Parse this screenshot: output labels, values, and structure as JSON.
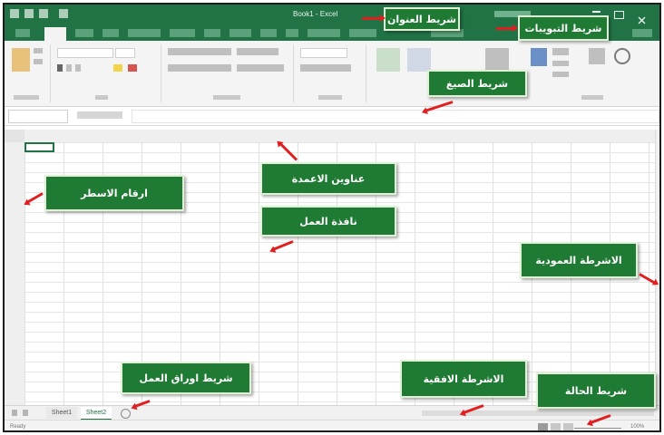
{
  "window": {
    "title": "Book1 - Excel",
    "sheet_tabs": [
      "Sheet1",
      "Sheet2"
    ],
    "status": "Ready",
    "zoom": "100%"
  },
  "labels": {
    "title_bar": "شريط العنوان",
    "tabs_bar": "شريط التبويبات",
    "formulas_bar": "شريط الصيغ",
    "column_headers": "عناوين الاعمدة",
    "row_numbers": "ارقام الاسطر",
    "work_window": "نافذة العمل",
    "vertical_bars": "الاشرطة العمودية",
    "sheets_bar": "شريط اوراق العمل",
    "horizontal_bars": "الاشرطة الافقية",
    "status_bar": "شريط الحالة"
  },
  "colors": {
    "excel_green": "#217346",
    "callout_green": "#1f7a34",
    "arrow_red": "#e02020"
  }
}
